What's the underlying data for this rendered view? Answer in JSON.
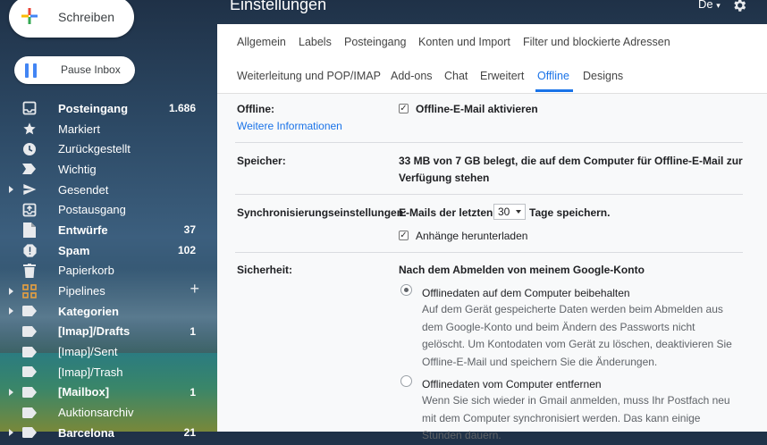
{
  "header": {
    "title": "Einstellungen",
    "lang": "De"
  },
  "sidebar": {
    "compose_label": "Schreiben",
    "pause_label": "Pause Inbox",
    "items": [
      {
        "label": "Posteingang",
        "count": "1.686",
        "bold": true,
        "icon": "inbox-icon"
      },
      {
        "label": "Markiert",
        "count": "",
        "bold": false,
        "icon": "star-icon"
      },
      {
        "label": "Zurückgestellt",
        "count": "",
        "bold": false,
        "icon": "clock-icon"
      },
      {
        "label": "Wichtig",
        "count": "",
        "bold": false,
        "icon": "important-icon"
      },
      {
        "label": "Gesendet",
        "count": "",
        "bold": false,
        "icon": "send-icon",
        "expander": true
      },
      {
        "label": "Postausgang",
        "count": "",
        "bold": false,
        "icon": "outbox-icon"
      },
      {
        "label": "Entwürfe",
        "count": "37",
        "bold": true,
        "icon": "draft-icon"
      },
      {
        "label": "Spam",
        "count": "102",
        "bold": true,
        "icon": "spam-icon"
      },
      {
        "label": "Papierkorb",
        "count": "",
        "bold": false,
        "icon": "trash-icon"
      },
      {
        "label": "Pipelines",
        "count": "",
        "bold": false,
        "icon": "grid-icon",
        "expander": true,
        "add": "+"
      },
      {
        "label": "Kategorien",
        "count": "",
        "bold": true,
        "icon": "label-icon",
        "expander": true
      },
      {
        "label": "[Imap]/Drafts",
        "count": "1",
        "bold": true,
        "icon": "label-icon"
      },
      {
        "label": "[Imap]/Sent",
        "count": "",
        "bold": false,
        "icon": "label-icon"
      },
      {
        "label": "[Imap]/Trash",
        "count": "",
        "bold": false,
        "icon": "label-icon"
      },
      {
        "label": "[Mailbox]",
        "count": "1",
        "bold": true,
        "icon": "label-icon",
        "expander": true
      },
      {
        "label": "Auktionsarchiv",
        "count": "",
        "bold": false,
        "icon": "label-icon"
      },
      {
        "label": "Barcelona",
        "count": "21",
        "bold": true,
        "icon": "label-icon",
        "expander": true
      }
    ]
  },
  "tabs": {
    "row1": [
      "Allgemein",
      "Labels",
      "Posteingang",
      "Konten und Import",
      "Filter und blockierte Adressen"
    ],
    "row2": [
      "Weiterleitung und POP/IMAP",
      "Add-ons",
      "Chat",
      "Erweitert",
      "Offline",
      "Designs"
    ],
    "active": "Offline"
  },
  "settings": {
    "offline": {
      "label": "Offline:",
      "link": "Weitere Informationen",
      "checkbox_label": "Offline-E-Mail aktivieren",
      "checked": true
    },
    "storage": {
      "label": "Speicher:",
      "line1": "33 MB von 7 GB belegt, die auf dem Computer für Offline-E-Mail zur",
      "line2": "Verfügung stehen"
    },
    "sync": {
      "label": "Synchronisierungseinstellungen:",
      "prefix": "E-Mails der letzten",
      "days": "30",
      "suffix": "Tage speichern.",
      "attachments_label": "Anhänge herunterladen",
      "attachments_checked": true
    },
    "security": {
      "label": "Sicherheit:",
      "heading": "Nach dem Abmelden von meinem Google-Konto",
      "option1_title": "Offlinedaten auf dem Computer beibehalten",
      "option1_desc": [
        "Auf dem Gerät gespeicherte Daten werden beim Abmelden aus",
        "dem Google-Konto und beim Ändern des Passworts nicht",
        "gelöscht. Um Kontodaten vom Gerät zu löschen, deaktivieren Sie",
        "Offline-E-Mail und speichern Sie die Änderungen."
      ],
      "option2_title": "Offlinedaten vom Computer entfernen",
      "option2_desc": [
        "Wenn Sie sich wieder in Gmail anmelden, muss Ihr Postfach neu",
        "mit dem Computer synchronisiert werden. Das kann einige",
        "Stunden dauern."
      ]
    }
  },
  "colors": {
    "accent": "#1a73e8",
    "panel_bg": "#f8f9fa"
  }
}
